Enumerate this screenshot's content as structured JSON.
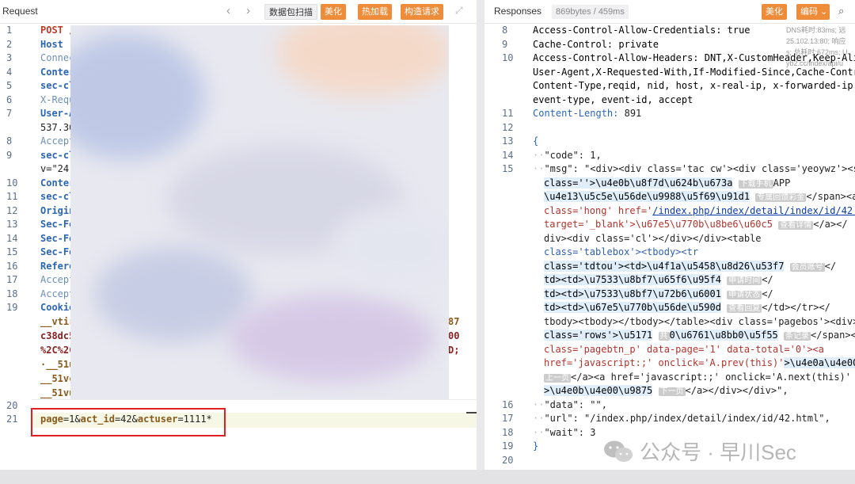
{
  "request": {
    "title": "Request",
    "nav_back": "‹",
    "nav_forward": "›",
    "buttons": {
      "scan": "数据包扫描",
      "beautify": "美化",
      "hot_load": "热加载",
      "build_request": "构造请求"
    },
    "line_numbers": [
      "1",
      "2",
      "3",
      "4",
      "5",
      "6",
      "7",
      "",
      "8",
      "9",
      "",
      "10",
      "11",
      "12",
      "13",
      "14",
      "15",
      "16",
      "17",
      "18",
      "19",
      "",
      "",
      "",
      "",
      "",
      "20",
      "21"
    ],
    "lines": {
      "l1": "POST /",
      "l2": "Host",
      "l3": "Connec",
      "l4": "Conter",
      "l5": "sec-cl",
      "l6": "X-Requ",
      "l7": "User-A",
      "l7b": "537.36",
      "l8": "Accept",
      "l9": "sec-cl",
      "l9b": "v=\"24\"",
      "l10": "Conter",
      "l11": "sec-cl",
      "l12": "Origin",
      "l13": "Sec-Fe",
      "l14": "Sec-Fe",
      "l15": "Sec-Fe",
      "l16": "Refere",
      "l17": "Accept",
      "l18": "Accept",
      "l19": "Cookie",
      "c1": "__vtir",
      "c1r": "87",
      "c2": "c38dc5",
      "c2r": "00",
      "c3": "%2C%2C",
      "c3r": "D;",
      "c4": "·__51u",
      "c5": "__51vc",
      "c6": "__51vu"
    },
    "body": {
      "p1": "page",
      "eq1": "=1&",
      "p2": "act_id",
      "eq2": "=42&",
      "p3": "actuser",
      "eq3": "=1111*"
    }
  },
  "response": {
    "title": "Responses",
    "size": "869bytes / 459ms",
    "buttons": {
      "beautify": "美化",
      "encoding": "编码"
    },
    "encoding_caret": "⌄",
    "side_info": [
      "DNS耗时:83ms; 远",
      "25.102.13:80; 响应",
      "s; 总耗时:672ms; U",
      "yb2.cc/index/api/u"
    ],
    "line_numbers": [
      "8",
      "9",
      "10",
      "",
      "",
      "",
      "11",
      "12",
      "13",
      "14",
      "15",
      "",
      "",
      "",
      "",
      "",
      "",
      "",
      "",
      "",
      "",
      "",
      "",
      "",
      "",
      "16",
      "17",
      "18",
      "19",
      "20"
    ],
    "headers": {
      "l8": "Access-Control-Allow-Credentials: true",
      "l9": "Cache-Control: private",
      "l10a": "Access-Control-Allow-Headers: DNT,X-CustomHeader,Keep-Aliv",
      "l10b": "User-Agent,X-Requested-With,If-Modified-Since,Cache-Contro",
      "l10c": "Content-Type,reqid, nid, host, x-real-ip, x-forwarded-ip, ",
      "l10d": "event-type, event-id, accept",
      "l11k": "Content-Length:",
      "l11v": " 891"
    },
    "json": {
      "brace_open": "{",
      "code_line": "\"code\": 1,",
      "msg_key": "\"msg\": ",
      "m1": "\"<div><div class='tac cw'><div class='yeoywz'><sp",
      "m2a": "class=''>\\u4e0b\\u8f7d\\u624b\\u673a",
      "m2ann": "下载手机",
      "m2b": "APP",
      "m3a": "\\u4e13\\u5c5e\\u56de\\u9988\\u5f69\\u91d1",
      "m3ann": "专属回馈彩金",
      "m3b": "</span><a",
      "m4a": "class='hong' href='",
      "m4url": "/index.php/index/detail/index/id/42.h",
      "m5a": "target='_blank'>\\u67e5\\u770b\\u8be6\\u60c5",
      "m5ann": "查看详情",
      "m5b": "</a></",
      "m6": "div><div class='cl'></div></div><table",
      "m7": "class='tablebox'><tbody><tr",
      "m8a": "class='tdtou'><td>\\u4f1a\\u5458\\u8d26\\u53f7",
      "m8ann": "会员账号",
      "m8b": "</",
      "m9a": "td><td>\\u7533\\u8bf7\\u65f6\\u95f4",
      "m9ann": "申请时间",
      "m9b": "</",
      "m10a": "td><td>\\u7533\\u8bf7\\u72b6\\u6001",
      "m10ann": "申请状态",
      "m10b": "</",
      "m11a": "td><td>\\u67e5\\u770b\\u56de\\u590d",
      "m11ann": "查看回复",
      "m11b": "</td></tr></",
      "m12": "tbody><tbody></tbody></table><div class='pagebos'><div><",
      "m13a": "class='rows'>\\u5171",
      "m13ann1": "共",
      "m13b": "0\\u6761\\u8bb0\\u5f55",
      "m13ann2": "条记录",
      "m13c": "</span><",
      "m14": "class='pagebtn_p' data-page='1' data-total='0'><a",
      "m15a": "href='javascript:;' onclick='A.prev(this)'",
      "m15b": ">\\u4e0a\\u4e00",
      "m16ann": "上一页",
      "m16b": "</a><a href='javascript:;' onclick='A.next(this)'",
      "m17a": ">\\u4e0b\\u4e00\\u9875",
      "m17ann": "下一页",
      "m17b": "</a></div></div>\",",
      "data_line": "\"data\": \"\",",
      "url_line": "\"url\": \"/index.php/index/detail/index/id/42.html\",",
      "wait_line": "\"wait\": 3",
      "brace_close": "}"
    }
  },
  "watermark": "公众号 · 早川Sec",
  "colors": {
    "accent": "#ef8c3a",
    "annotation_border": "#e02020"
  }
}
